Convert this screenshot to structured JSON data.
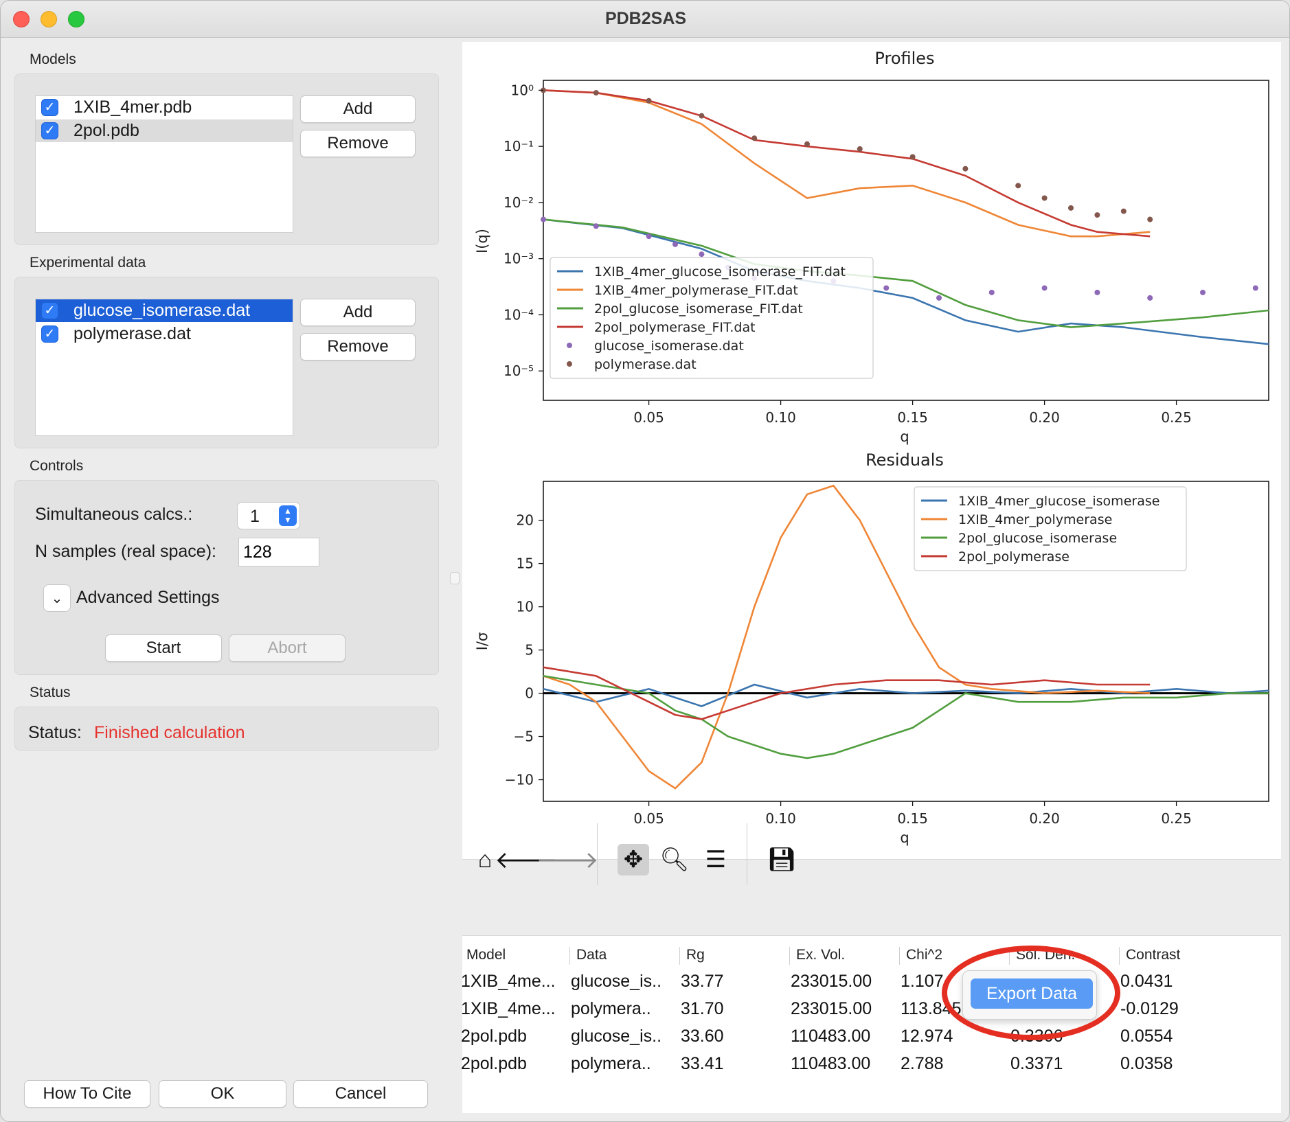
{
  "window": {
    "title": "PDB2SAS"
  },
  "models": {
    "label": "Models",
    "items": [
      {
        "name": "1XIB_4mer.pdb",
        "checked": true
      },
      {
        "name": "2pol.pdb",
        "checked": true
      }
    ],
    "add_label": "Add",
    "remove_label": "Remove"
  },
  "experimental": {
    "label": "Experimental data",
    "items": [
      {
        "name": "glucose_isomerase.dat",
        "checked": true
      },
      {
        "name": "polymerase.dat",
        "checked": true
      }
    ],
    "add_label": "Add",
    "remove_label": "Remove"
  },
  "controls": {
    "label": "Controls",
    "simultaneous_label": "Simultaneous calcs.:",
    "simultaneous_value": "1",
    "nsamples_label": "N samples (real space):",
    "nsamples_value": "128",
    "advanced_label": "Advanced Settings",
    "start_label": "Start",
    "abort_label": "Abort"
  },
  "status": {
    "label": "Status",
    "status_label": "Status:",
    "status_value": "Finished calculation",
    "status_color": "#e5322d"
  },
  "footer": {
    "cite_label": "How To Cite",
    "ok_label": "OK",
    "cancel_label": "Cancel"
  },
  "toolbar": {
    "icons": [
      "home-icon",
      "back-arrow-icon",
      "forward-arrow-icon",
      "pan-icon",
      "zoom-icon",
      "configure-icon",
      "save-icon"
    ]
  },
  "chart_data": [
    {
      "type": "line",
      "title": "Profiles",
      "xlabel": "q",
      "ylabel": "I(q)",
      "yscale": "log",
      "xlim": [
        0.01,
        0.285
      ],
      "ylim": [
        3e-06,
        1.5
      ],
      "xticks": [
        "0.05",
        "0.10",
        "0.15",
        "0.20",
        "0.25"
      ],
      "yticks": [
        "10⁰",
        "10⁻¹",
        "10⁻²",
        "10⁻³",
        "10⁻⁴",
        "10⁻⁵"
      ],
      "legend": "lower-left",
      "series": [
        {
          "name": "1XIB_4mer_glucose_isomerase_FIT.dat",
          "color": "#3b75af",
          "x": [
            0.01,
            0.04,
            0.07,
            0.09,
            0.11,
            0.13,
            0.15,
            0.17,
            0.19,
            0.21,
            0.23,
            0.26,
            0.285
          ],
          "y": [
            0.005,
            0.0035,
            0.0015,
            0.0006,
            0.0004,
            0.0003,
            0.0002,
            8e-05,
            5e-05,
            7e-05,
            6e-05,
            4e-05,
            3e-05
          ]
        },
        {
          "name": "1XIB_4mer_polymerase_FIT.dat",
          "color": "#ef8636",
          "x": [
            0.01,
            0.03,
            0.05,
            0.07,
            0.09,
            0.11,
            0.13,
            0.15,
            0.17,
            0.19,
            0.21,
            0.22,
            0.24
          ],
          "y": [
            1.0,
            0.9,
            0.6,
            0.25,
            0.05,
            0.012,
            0.018,
            0.02,
            0.01,
            0.004,
            0.0025,
            0.0025,
            0.003
          ]
        },
        {
          "name": "2pol_glucose_isomerase_FIT.dat",
          "color": "#519e3e",
          "x": [
            0.01,
            0.04,
            0.07,
            0.09,
            0.11,
            0.13,
            0.15,
            0.17,
            0.19,
            0.21,
            0.23,
            0.26,
            0.285
          ],
          "y": [
            0.005,
            0.0036,
            0.0017,
            0.0008,
            0.0006,
            0.0005,
            0.0004,
            0.00015,
            8e-05,
            6e-05,
            7e-05,
            9e-05,
            0.00012
          ]
        },
        {
          "name": "2pol_polymerase_FIT.dat",
          "color": "#c53a32",
          "x": [
            0.01,
            0.03,
            0.05,
            0.07,
            0.09,
            0.11,
            0.13,
            0.15,
            0.17,
            0.19,
            0.21,
            0.22,
            0.24
          ],
          "y": [
            1.0,
            0.9,
            0.65,
            0.35,
            0.13,
            0.1,
            0.08,
            0.06,
            0.03,
            0.01,
            0.004,
            0.003,
            0.0025
          ]
        },
        {
          "name": "glucose_isomerase.dat",
          "color": "#8d69b8",
          "marker": "dot",
          "x": [
            0.01,
            0.03,
            0.05,
            0.06,
            0.07,
            0.08,
            0.09,
            0.1,
            0.12,
            0.14,
            0.16,
            0.18,
            0.2,
            0.22,
            0.24,
            0.26,
            0.28
          ],
          "y": [
            0.005,
            0.0038,
            0.0025,
            0.0018,
            0.0012,
            0.0007,
            0.00045,
            0.0003,
            0.0004,
            0.0003,
            0.0002,
            0.00025,
            0.0003,
            0.00025,
            0.0002,
            0.00025,
            0.0003
          ]
        },
        {
          "name": "polymerase.dat",
          "color": "#84574d",
          "marker": "dot",
          "x": [
            0.01,
            0.03,
            0.05,
            0.07,
            0.09,
            0.11,
            0.13,
            0.15,
            0.17,
            0.19,
            0.2,
            0.21,
            0.22,
            0.23,
            0.24
          ],
          "y": [
            1.0,
            0.9,
            0.65,
            0.35,
            0.14,
            0.11,
            0.09,
            0.065,
            0.04,
            0.02,
            0.012,
            0.008,
            0.006,
            0.007,
            0.005
          ]
        }
      ]
    },
    {
      "type": "line",
      "title": "Residuals",
      "xlabel": "q",
      "ylabel": "I/σ",
      "xlim": [
        0.01,
        0.285
      ],
      "ylim": [
        -12.5,
        24.5
      ],
      "xticks": [
        "0.05",
        "0.10",
        "0.15",
        "0.20",
        "0.25"
      ],
      "yticks": [
        "20",
        "15",
        "10",
        "5",
        "0",
        "−5",
        "−10"
      ],
      "legend": "upper-right",
      "series": [
        {
          "name": "1XIB_4mer_glucose_isomerase",
          "color": "#3b75af",
          "x": [
            0.01,
            0.03,
            0.05,
            0.07,
            0.09,
            0.11,
            0.13,
            0.15,
            0.17,
            0.19,
            0.21,
            0.23,
            0.25,
            0.27,
            0.285
          ],
          "y": [
            0.5,
            -1,
            0.5,
            -1.5,
            1,
            -0.5,
            0.5,
            0,
            0.3,
            0,
            0.5,
            0,
            0.5,
            0,
            0.3
          ]
        },
        {
          "name": "1XIB_4mer_polymerase",
          "color": "#ef8636",
          "x": [
            0.01,
            0.02,
            0.03,
            0.04,
            0.05,
            0.06,
            0.07,
            0.08,
            0.09,
            0.1,
            0.11,
            0.12,
            0.13,
            0.14,
            0.15,
            0.16,
            0.17,
            0.18,
            0.2,
            0.22,
            0.24
          ],
          "y": [
            2,
            1,
            -1,
            -5,
            -9,
            -11,
            -8,
            0,
            10,
            18,
            23,
            24,
            20,
            14,
            8,
            3,
            1,
            0.5,
            0,
            0.3,
            0
          ]
        },
        {
          "name": "2pol_glucose_isomerase",
          "color": "#519e3e",
          "x": [
            0.01,
            0.03,
            0.05,
            0.06,
            0.07,
            0.08,
            0.09,
            0.1,
            0.11,
            0.12,
            0.13,
            0.14,
            0.15,
            0.16,
            0.17,
            0.19,
            0.21,
            0.23,
            0.25,
            0.27,
            0.285
          ],
          "y": [
            2,
            1,
            0,
            -2,
            -3,
            -5,
            -6,
            -7,
            -7.5,
            -7,
            -6,
            -5,
            -4,
            -2,
            0,
            -1,
            -1,
            -0.5,
            -0.5,
            0,
            0
          ]
        },
        {
          "name": "2pol_polymerase",
          "color": "#c53a32",
          "x": [
            0.01,
            0.03,
            0.05,
            0.06,
            0.07,
            0.08,
            0.09,
            0.1,
            0.12,
            0.14,
            0.16,
            0.18,
            0.2,
            0.22,
            0.24
          ],
          "y": [
            3,
            2,
            -1,
            -2.5,
            -3,
            -2,
            -1,
            0,
            1,
            1.5,
            1.5,
            1,
            1.5,
            1,
            1
          ]
        }
      ]
    }
  ],
  "table": {
    "headers": [
      "Model",
      "Data",
      "Rg",
      "Ex. Vol.",
      "Chi^2",
      "Sol. Den.",
      "Contrast"
    ],
    "rows": [
      [
        "1XIB_4me...",
        "glucose_is..",
        "33.77",
        "233015.00",
        "1.107",
        "",
        "0.0431"
      ],
      [
        "1XIB_4me...",
        "polymera..",
        "31.70",
        "233015.00",
        "113.845",
        "",
        "-0.0129"
      ],
      [
        "2pol.pdb",
        "glucose_is..",
        "33.60",
        "110483.00",
        "12.974",
        "0.3306",
        "0.0554"
      ],
      [
        "2pol.pdb",
        "polymera..",
        "33.41",
        "110483.00",
        "2.788",
        "0.3371",
        "0.0358"
      ]
    ]
  },
  "popup": {
    "export_label": "Export Data"
  }
}
